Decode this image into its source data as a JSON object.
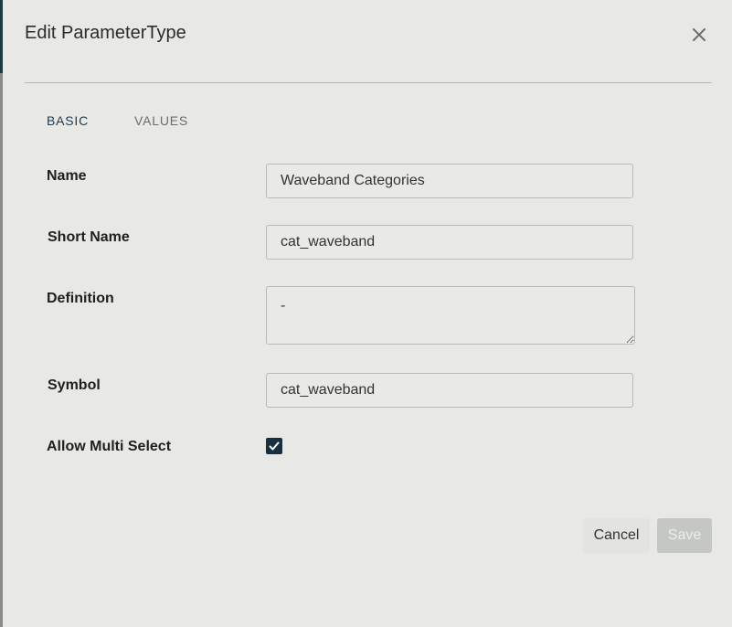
{
  "dialog": {
    "title": "Edit ParameterType"
  },
  "tabs": [
    {
      "label": "BASIC",
      "active": true
    },
    {
      "label": "VALUES",
      "active": false
    }
  ],
  "fields": {
    "name": {
      "label": "Name",
      "value": "Waveband Categories"
    },
    "short_name": {
      "label": "Short Name",
      "value": "cat_waveband"
    },
    "definition": {
      "label": "Definition",
      "value": "-"
    },
    "symbol": {
      "label": "Symbol",
      "value": "cat_waveband"
    },
    "allow_multi_select": {
      "label": "Allow Multi Select",
      "checked": true
    }
  },
  "actions": {
    "cancel_label": "Cancel",
    "save_label": "Save",
    "save_disabled": true
  },
  "icons": {
    "close": "close-icon",
    "checkbox": "checkmark-icon"
  },
  "colors": {
    "accent": "#173040",
    "tab_active": "#1f3a50",
    "tab_inactive": "#6b6b6b",
    "background": "#e8e8e4"
  }
}
